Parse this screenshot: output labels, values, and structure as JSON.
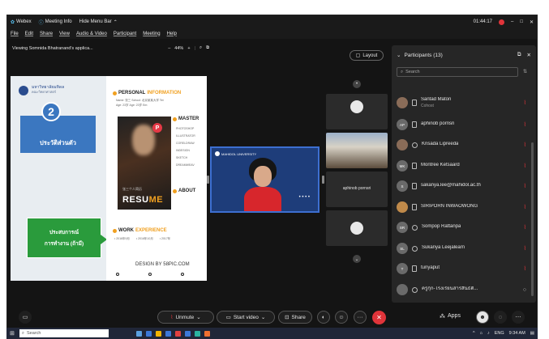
{
  "titlebar": {
    "app": "Webex",
    "meeting_info": "Meeting Info",
    "hide_menu": "Hide Menu Bar",
    "time": "01:44:17",
    "minimize": "–",
    "restore": "□",
    "close": "✕"
  },
  "menu": [
    "File",
    "Edit",
    "Share",
    "View",
    "Audio & Video",
    "Participant",
    "Meeting",
    "Help"
  ],
  "sharebar": {
    "title": "Viewing Somnida Bhatranand's applica...",
    "zoom_minus": "–",
    "zoom": "44%",
    "zoom_plus": "+"
  },
  "slide": {
    "uni_name": "มหาวิทยาลัยมหิดล",
    "uni_sub": "คณะวิทยาศาสตร์",
    "number": "2",
    "personal_label": "ประวัติส่วนตัว",
    "work_label_1": "ประสบการณ์",
    "work_label_2": "การทำงาน (ถ้ามี)",
    "personal_head": "PERSONAL",
    "personal_accent": "INFORMATION",
    "name_line": "Name: 张三     School: 北京某某大学     Tel:",
    "age_line": "Age: 23岁     Age: 23岁     Em:",
    "master_head": "MASTER",
    "skills": [
      "PHOTOSHOP",
      "ILLUSTRATOR",
      "CORELDRAW",
      "INDESIGN",
      "SKETCH",
      "DREAMWEAV"
    ],
    "about_head": "ABOUT",
    "resume_cn": "张三个人简历",
    "resume_main": "RESU",
    "resume_accent": "ME",
    "work_head": "WORK",
    "work_accent": "EXPERIENCE",
    "years": [
      "• 2016年9月",
      "• 2016年10月",
      "• 2017年"
    ],
    "watermark": "DESIGN BY 58PIC.COM"
  },
  "main_video": {
    "logo_text": "MAHIDOL UNIVERSITY",
    "dots": "• • • •"
  },
  "layout_label": "Layout",
  "tiles": [
    {
      "name": ""
    },
    {
      "name": ""
    },
    {
      "name": "aphinob pornsri"
    },
    {
      "name": ""
    }
  ],
  "participants": {
    "header": "Participants (13)",
    "search_placeholder": "Search",
    "list": [
      {
        "name": "Santad Maton",
        "role": "Cohost",
        "initials": "",
        "device": "phone"
      },
      {
        "name": "aphinob pornsri",
        "role": "",
        "initials": "AP",
        "device": "phone"
      },
      {
        "name": "Krisada Lipreeda",
        "role": "",
        "initials": "",
        "device": "web"
      },
      {
        "name": "Montree Ketsaard",
        "role": "",
        "initials": "MK",
        "device": "phone"
      },
      {
        "name": "sakanya.lee@mahidol.ac.th",
        "role": "",
        "initials": "S",
        "device": "phone"
      },
      {
        "name": "SIRIPORN INWAOWONG",
        "role": "",
        "initials": "",
        "device": "phone"
      },
      {
        "name": "Sompop Rattanpa",
        "role": "",
        "initials": "SR",
        "device": "web"
      },
      {
        "name": "Sukanya Leejalearn",
        "role": "",
        "initials": "SL",
        "device": "web"
      },
      {
        "name": "tunyaput",
        "role": "",
        "initials": "T",
        "device": "phone"
      },
      {
        "name": "ครูกุ๊ก-โรงเรียนสารสินธ์ติ...",
        "role": "",
        "initials": "",
        "device": "web"
      }
    ]
  },
  "controls": {
    "unmute": "Unmute",
    "start_video": "Start video",
    "share": "Share",
    "apps": "Apps",
    "more": "···",
    "leave": "✕"
  },
  "taskbar": {
    "search": "Search",
    "lang": "ENG",
    "time": "9:34 AM"
  },
  "colors": {
    "accent_blue": "#3b77c0",
    "leave_red": "#e0343a",
    "green": "#2a9b3c",
    "orange": "#f0a020"
  }
}
